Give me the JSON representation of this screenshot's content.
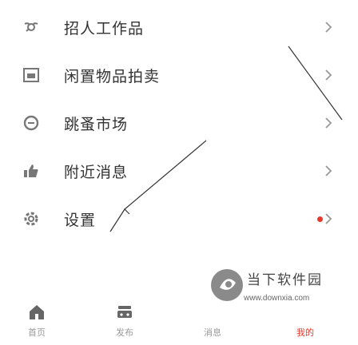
{
  "menu": {
    "items": [
      {
        "label": "招人工作品",
        "icon": "dandelion-icon",
        "chevron": "›",
        "badge": false
      },
      {
        "label": "闲置物品拍卖",
        "icon": "folder-icon",
        "chevron": "›",
        "badge": false
      },
      {
        "label": "跳蚤市场",
        "icon": "chat-icon",
        "chevron": "›",
        "badge": false
      },
      {
        "label": "附近消息",
        "icon": "thumbs-up-icon",
        "chevron": "›",
        "badge": false
      },
      {
        "label": "设置",
        "icon": "gear-icon",
        "chevron": "›",
        "badge": true
      }
    ]
  },
  "tabbar": {
    "tabs": [
      {
        "label": "首页",
        "icon": "home-icon",
        "active": false
      },
      {
        "label": "发布",
        "icon": "car-icon",
        "active": false
      },
      {
        "label": "消息",
        "icon": "bell-icon",
        "active": false
      },
      {
        "label": "我的",
        "icon": "user-icon",
        "active": true
      }
    ]
  },
  "watermark": {
    "title": "当下软件园",
    "url": "www.downxia.com"
  },
  "colors": {
    "accent": "#e6392b",
    "text": "#333333",
    "chevron": "#999999",
    "icon": "#666666"
  }
}
